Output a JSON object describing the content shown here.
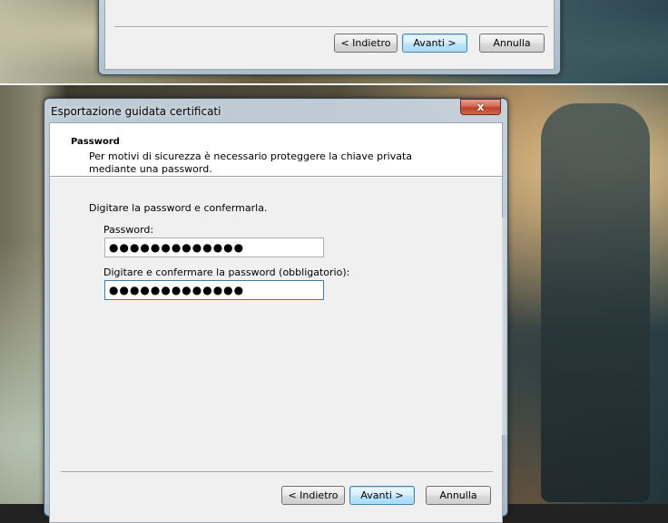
{
  "top_window": {
    "buttons": {
      "back": "< Indietro",
      "next": "Avanti >",
      "cancel": "Annulla"
    }
  },
  "dialog": {
    "title": "Esportazione guidata certificati",
    "close_glyph": "x",
    "header": {
      "heading": "Password",
      "description": "Per motivi di sicurezza è necessario proteggere la chiave privata mediante una password."
    },
    "instruction": "Digitare la password e confermarla.",
    "password_label": "Password:",
    "password_value": "●●●●●●●●●●●●●",
    "confirm_label": "Digitare e confermare la password (obbligatorio):",
    "confirm_value": "●●●●●●●●●●●●●",
    "buttons": {
      "back": "< Indietro",
      "next": "Avanti >",
      "cancel": "Annulla"
    }
  }
}
